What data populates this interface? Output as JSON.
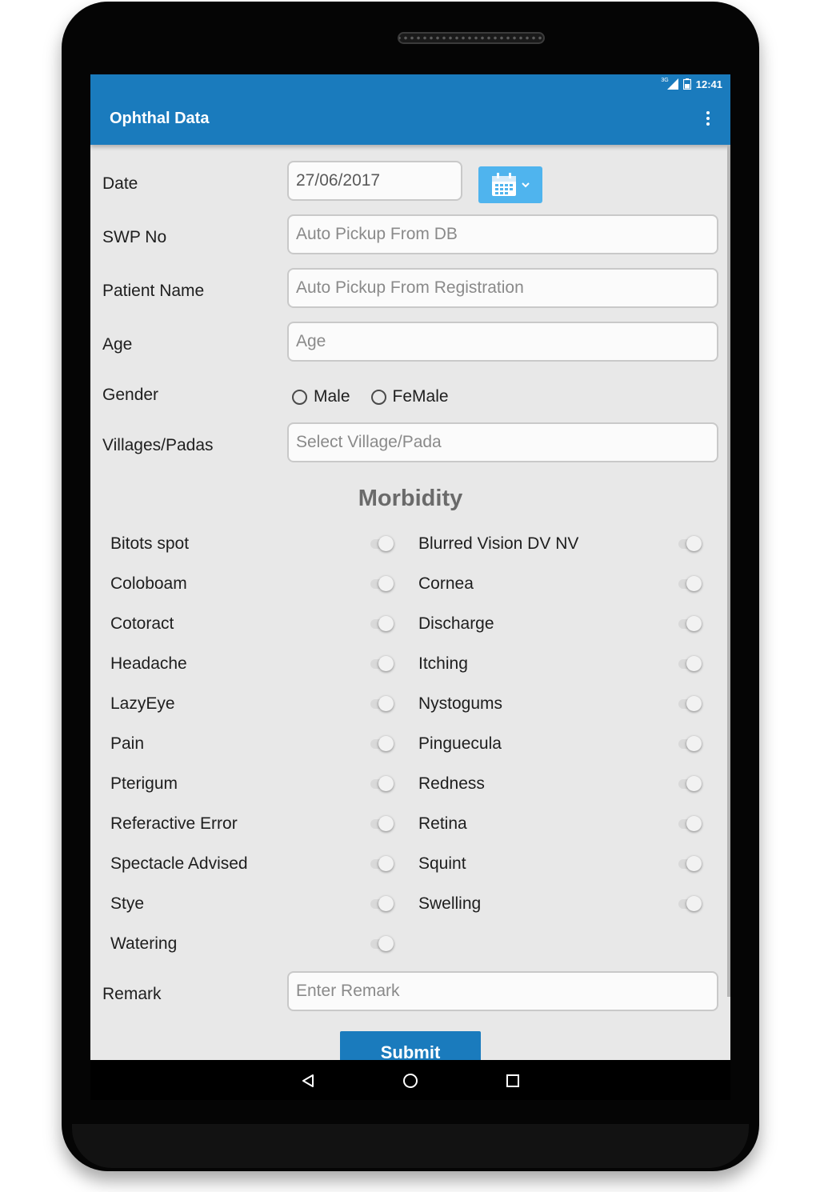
{
  "statusbar": {
    "network": "3G",
    "time": "12:41"
  },
  "appbar": {
    "title": "Ophthal Data",
    "menu_icon": "overflow-menu-icon"
  },
  "form": {
    "date": {
      "label": "Date",
      "value": "27/06/2017",
      "calendar_icon": "calendar-icon"
    },
    "swp_no": {
      "label": "SWP No",
      "placeholder": "Auto Pickup From DB"
    },
    "patient_name": {
      "label": "Patient Name",
      "placeholder": "Auto Pickup From Registration"
    },
    "age": {
      "label": "Age",
      "placeholder": "Age"
    },
    "gender": {
      "label": "Gender",
      "options": [
        "Male",
        "FeMale"
      ]
    },
    "village": {
      "label": "Villages/Padas",
      "placeholder": "Select Village/Pada"
    },
    "remark": {
      "label": "Remark",
      "placeholder": "Enter Remark"
    },
    "submit_label": "Submit"
  },
  "morbidity": {
    "title": "Morbidity",
    "items": [
      "Bitots spot",
      "Blurred Vision DV NV",
      "Coloboam",
      "Cornea",
      "Cotoract",
      "Discharge",
      "Headache",
      "Itching",
      "LazyEye",
      "Nystogums",
      "Pain",
      "Pinguecula",
      "Pterigum",
      "Redness",
      "Referactive Error",
      "Retina",
      "Spectacle Advised",
      "Squint",
      "Stye",
      "Swelling",
      "Watering"
    ]
  },
  "navbar": {
    "back_icon": "back-icon",
    "home_icon": "home-icon",
    "recents_icon": "recents-icon"
  }
}
